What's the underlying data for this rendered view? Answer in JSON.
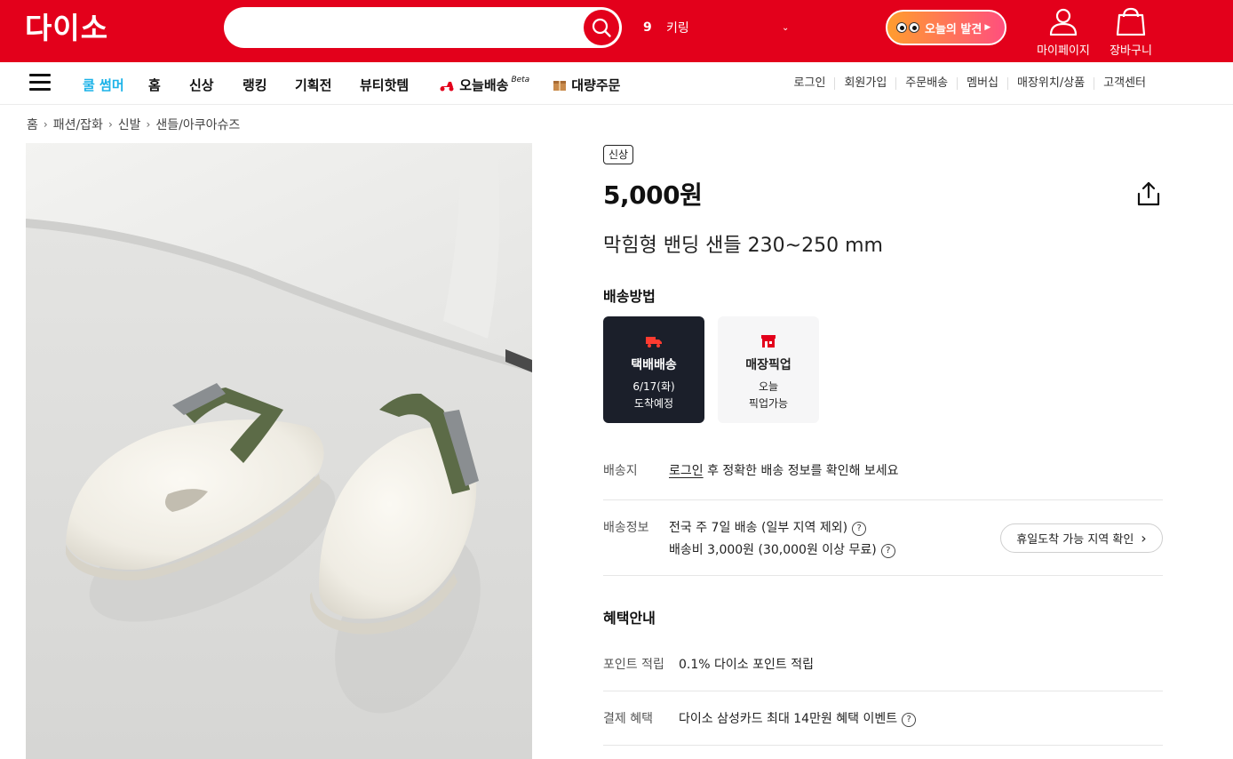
{
  "header": {
    "logo": "다이소",
    "search_placeholder": "",
    "rank_number": "9",
    "rank_keyword": "키링",
    "discover_label": "오늘의 발견",
    "mypage_label": "마이페이지",
    "cart_label": "장바구니",
    "brand_color": "#e3001b"
  },
  "nav": {
    "items": [
      "쿨 썸머",
      "홈",
      "신상",
      "랭킹",
      "기획전",
      "뷰티핫템",
      "오늘배송",
      "대량주문"
    ],
    "beta": "Beta",
    "util": [
      "로그인",
      "회원가입",
      "주문배송",
      "멤버십",
      "매장위치/상품",
      "고객센터"
    ]
  },
  "breadcrumb": [
    "홈",
    "패션/잡화",
    "신발",
    "샌들/아쿠아슈즈"
  ],
  "product": {
    "badge": "신상",
    "price": "5,000원",
    "name": "막힘형 밴딩 샌들 230~250 mm"
  },
  "shipping": {
    "title": "배송방법",
    "options": [
      {
        "title": "택배배송",
        "line1": "6/17(화)",
        "line2": "도착예정",
        "selected": true
      },
      {
        "title": "매장픽업",
        "line1": "오늘",
        "line2": "픽업가능",
        "selected": false
      }
    ],
    "dest_label": "배송지",
    "dest_link": "로그인",
    "dest_text": " 후 정확한 배송 정보를 확인해 보세요",
    "info_label": "배송정보",
    "info_line1": "전국 주 7일 배송 (일부 지역 제외)",
    "info_line2": "배송비 3,000원 (30,000원 이상 무료)",
    "holiday_button": "휴일도착 가능 지역 확인"
  },
  "benefits": {
    "title": "혜택안내",
    "point_label": "포인트 적립",
    "point_text": "0.1% 다이소 포인트 적립",
    "pay_label": "결제 혜택",
    "pay_text": "다이소 삼성카드 최대 14만원 혜택 이벤트"
  }
}
